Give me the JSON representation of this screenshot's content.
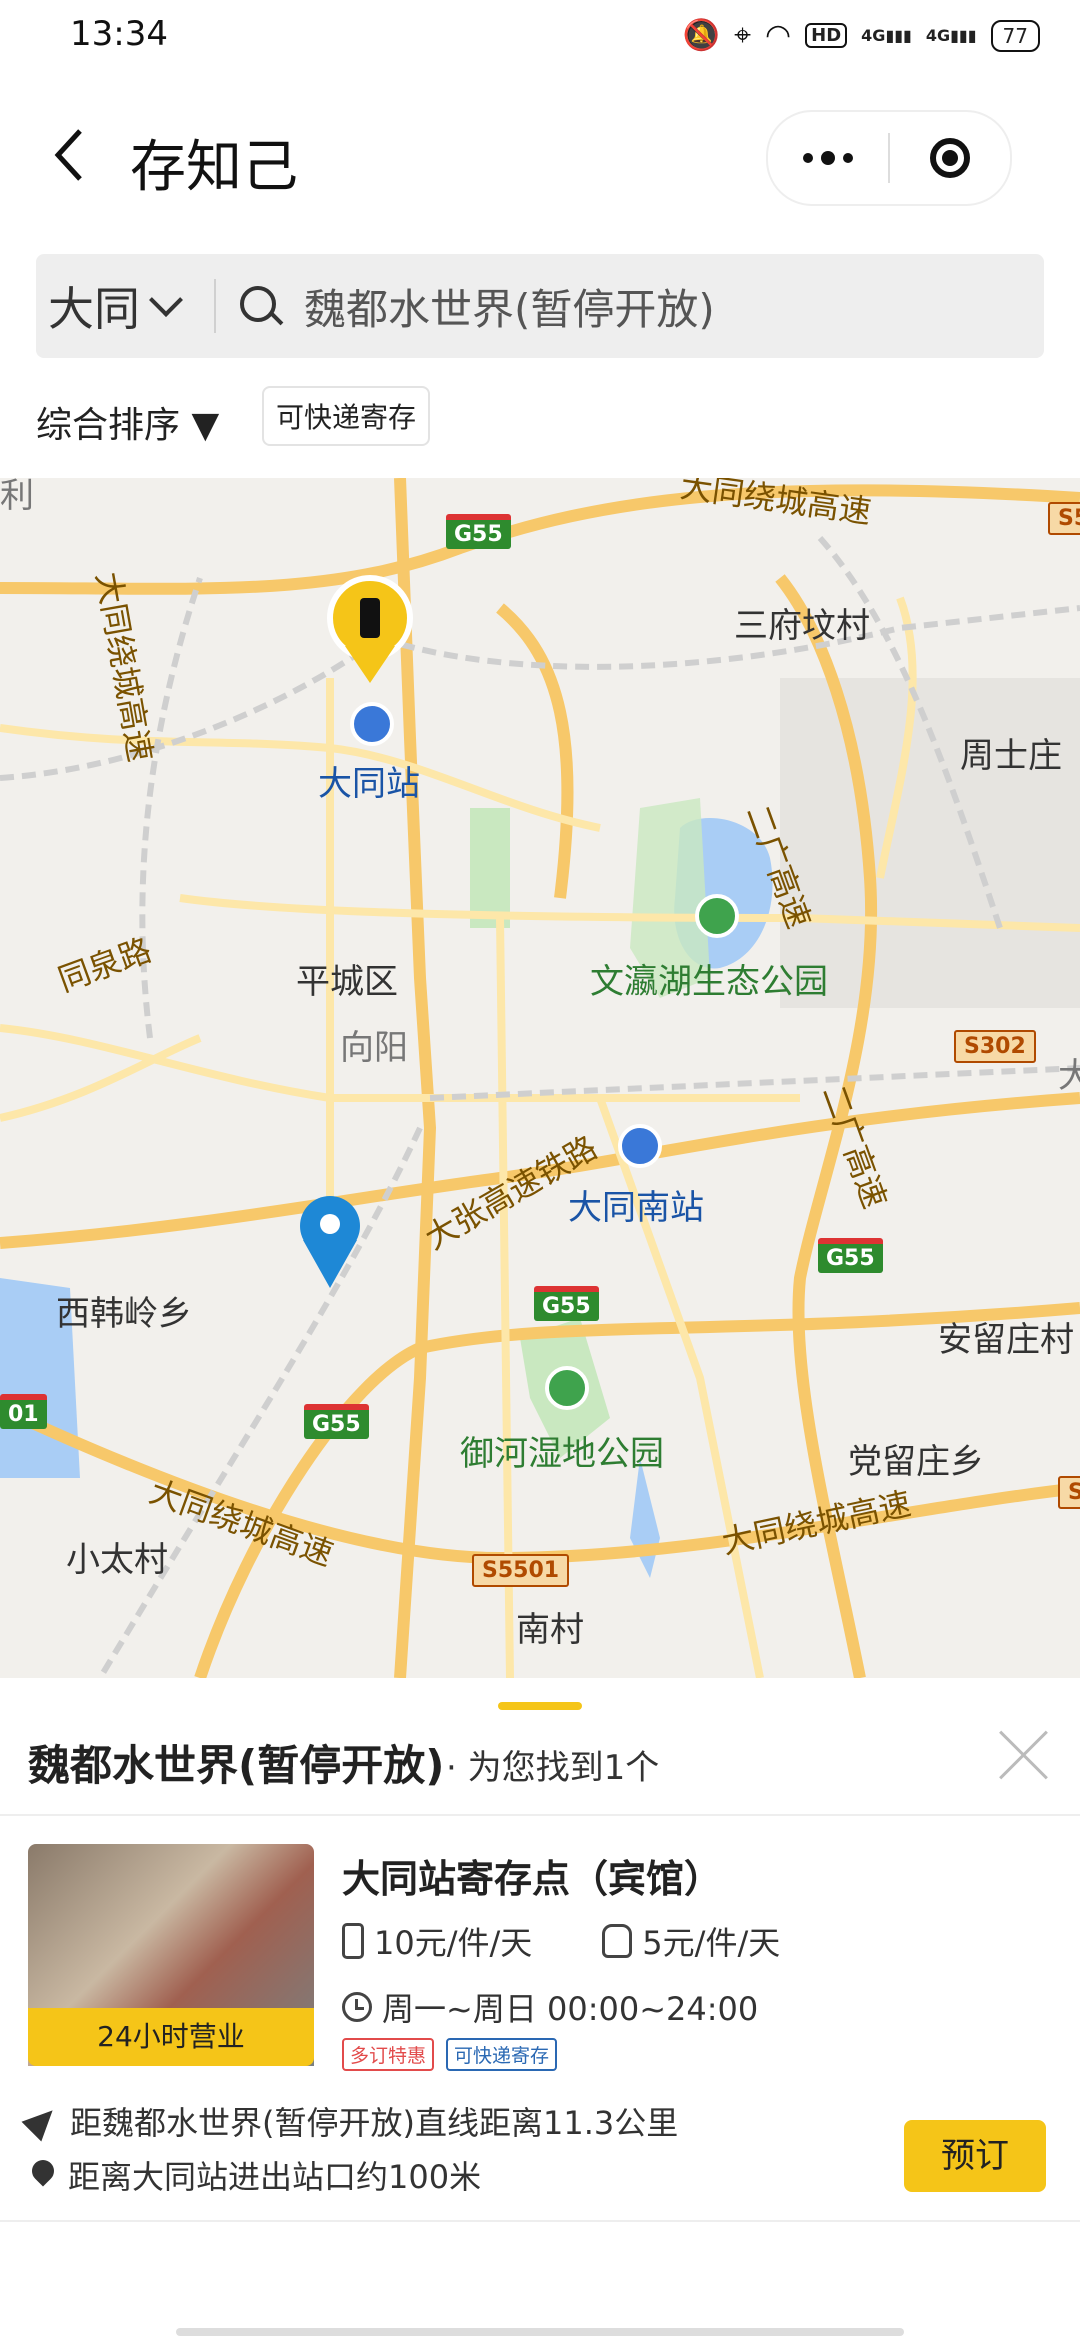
{
  "status_bar": {
    "time": "13:34",
    "network_a": "4G",
    "network_b": "4G",
    "battery": "77",
    "hd": "HD"
  },
  "nav": {
    "title": "存知己"
  },
  "search": {
    "city": "大同",
    "query": "魏都水世界(暂停开放)"
  },
  "filters": {
    "sort_label": "综合排序 ▼",
    "express_chip": "可快递寄存"
  },
  "map": {
    "labels": {
      "datong_station": "大同站",
      "datong_south": "大同南站",
      "pingcheng": "平城区",
      "xiangyang": "向阳",
      "wenying_park": "文瀛湖生态公园",
      "yuhe_park": "御河湿地公园",
      "sanfu": "三府坟村",
      "zhoushizhuang": "周士庄",
      "xihanling": "西韩岭乡",
      "xiaotai": "小太村",
      "nancun": "南村",
      "anliuzhuang": "安留庄村",
      "dangliuzhuang": "党留庄乡",
      "tongquan_road": "同泉路",
      "ring_expressway_a": "大同绕城高速",
      "ring_expressway_b": "大同绕城高速",
      "ring_expressway_top": "大同绕城高速",
      "ring_expressway_vertical": "大同绕城高速",
      "erguang_a": "二广高速",
      "erguang_b": "二广高速",
      "dazhang_railway": "大张高速铁路",
      "partial_left": "利",
      "partial_right": "大",
      "partial_right2": "S5",
      "partial_right3": "S",
      "partial_left_shield": "01"
    },
    "shields": {
      "g55_a": "G55",
      "g55_b": "G55",
      "g55_c": "G55",
      "g55_d": "G55",
      "s302": "S302",
      "s5501": "S5501"
    }
  },
  "results": {
    "title": "魏都水世界(暂停开放)",
    "count_text": "· 为您找到1个",
    "item": {
      "hours_badge": "24小时营业",
      "name": "大同站寄存点（宾馆）",
      "price_luggage": "10元/件/天",
      "price_bag": "5元/件/天",
      "open_hours": "周一~周日 00:00~24:00",
      "tag_discount": "多订特惠",
      "tag_express": "可快递寄存",
      "distance": "距魏都水世界(暂停开放)直线距离11.3公里",
      "location_note": "距离大同站进出站口约100米",
      "book_label": "预订"
    }
  },
  "colors": {
    "accent": "#f5c518",
    "map_blue_pin": "#1e88d6",
    "park_green": "#2e7d32"
  }
}
